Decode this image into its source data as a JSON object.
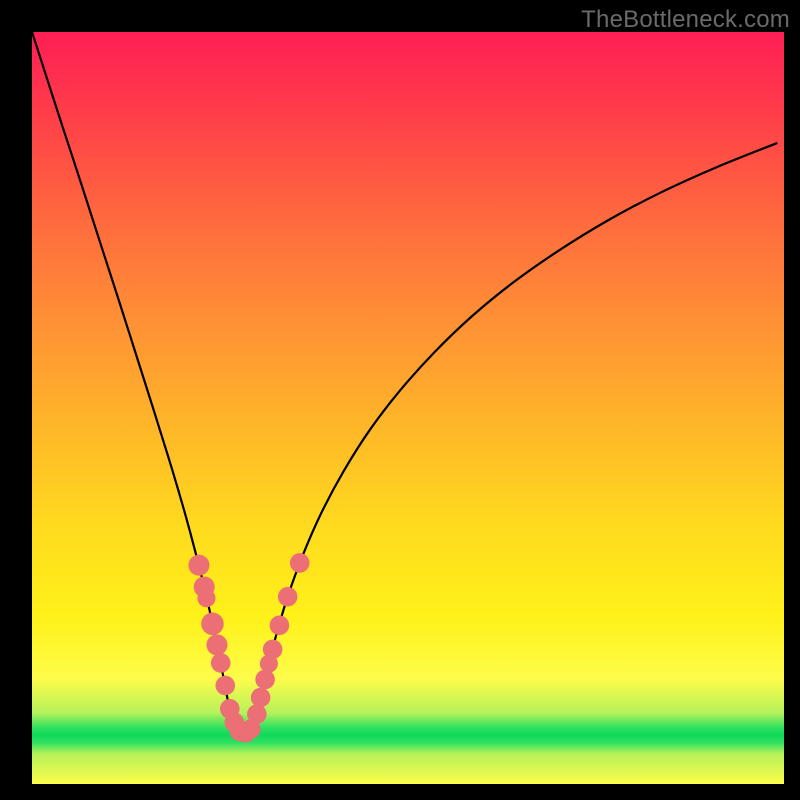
{
  "watermark": "TheBottleneck.com",
  "chart_data": {
    "type": "line",
    "title": "",
    "xlabel": "",
    "ylabel": "",
    "xlim": [
      0,
      100
    ],
    "ylim": [
      0,
      100
    ],
    "grid": false,
    "legend": false,
    "gradient_colors": {
      "top": "#ff1e55",
      "mid_upper": "#ff8f35",
      "mid": "#ffdb1e",
      "green_band": "#0fd85a",
      "bottom": "#fdfc4a"
    },
    "green_band_y": 7,
    "series": [
      {
        "name": "left-branch",
        "stroke": "#000000",
        "x": [
          0.0,
          2.0,
          4.0,
          6.0,
          8.0,
          10.0,
          12.0,
          14.0,
          16.0,
          18.0,
          19.0,
          20.0,
          21.0,
          22.0,
          22.8,
          23.5,
          24.2,
          25.0,
          25.8,
          26.6
        ],
        "y": [
          100.0,
          93.8,
          87.6,
          81.5,
          75.3,
          69.1,
          62.9,
          56.6,
          50.3,
          43.9,
          40.6,
          37.2,
          33.6,
          29.8,
          26.6,
          23.6,
          20.4,
          16.5,
          12.4,
          8.0
        ]
      },
      {
        "name": "valley-floor",
        "stroke": "#000000",
        "x": [
          26.6,
          27.6,
          28.6,
          29.6
        ],
        "y": [
          8.0,
          6.8,
          6.8,
          8.0
        ]
      },
      {
        "name": "right-branch",
        "stroke": "#000000",
        "x": [
          29.6,
          30.5,
          31.5,
          32.5,
          34.0,
          36.0,
          38.5,
          41.5,
          45.0,
          49.0,
          53.5,
          58.5,
          64.0,
          70.0,
          76.5,
          83.5,
          91.0,
          99.0
        ],
        "y": [
          8.0,
          11.9,
          16.0,
          19.9,
          24.9,
          30.4,
          36.1,
          41.7,
          47.2,
          52.4,
          57.4,
          62.2,
          66.7,
          70.9,
          74.9,
          78.6,
          82.0,
          85.2
        ]
      }
    ],
    "markers": {
      "series_name": "marker-dots",
      "color": "#eb6f74",
      "points": [
        {
          "x": 22.2,
          "y": 29.1,
          "r": 1.4
        },
        {
          "x": 22.9,
          "y": 26.2,
          "r": 1.4
        },
        {
          "x": 23.2,
          "y": 24.7,
          "r": 1.2
        },
        {
          "x": 24.0,
          "y": 21.3,
          "r": 1.5
        },
        {
          "x": 24.6,
          "y": 18.5,
          "r": 1.4
        },
        {
          "x": 25.1,
          "y": 16.1,
          "r": 1.3
        },
        {
          "x": 25.7,
          "y": 13.1,
          "r": 1.3
        },
        {
          "x": 26.3,
          "y": 10.0,
          "r": 1.3
        },
        {
          "x": 26.9,
          "y": 8.2,
          "r": 1.3
        },
        {
          "x": 27.6,
          "y": 7.0,
          "r": 1.3
        },
        {
          "x": 28.4,
          "y": 6.8,
          "r": 1.3
        },
        {
          "x": 29.1,
          "y": 7.3,
          "r": 1.3
        },
        {
          "x": 29.9,
          "y": 9.3,
          "r": 1.3
        },
        {
          "x": 30.4,
          "y": 11.5,
          "r": 1.3
        },
        {
          "x": 31.0,
          "y": 13.9,
          "r": 1.3
        },
        {
          "x": 31.5,
          "y": 16.0,
          "r": 1.2
        },
        {
          "x": 32.0,
          "y": 17.9,
          "r": 1.3
        },
        {
          "x": 32.9,
          "y": 21.1,
          "r": 1.3
        },
        {
          "x": 34.0,
          "y": 24.9,
          "r": 1.3
        },
        {
          "x": 35.6,
          "y": 29.4,
          "r": 1.3
        }
      ]
    }
  }
}
